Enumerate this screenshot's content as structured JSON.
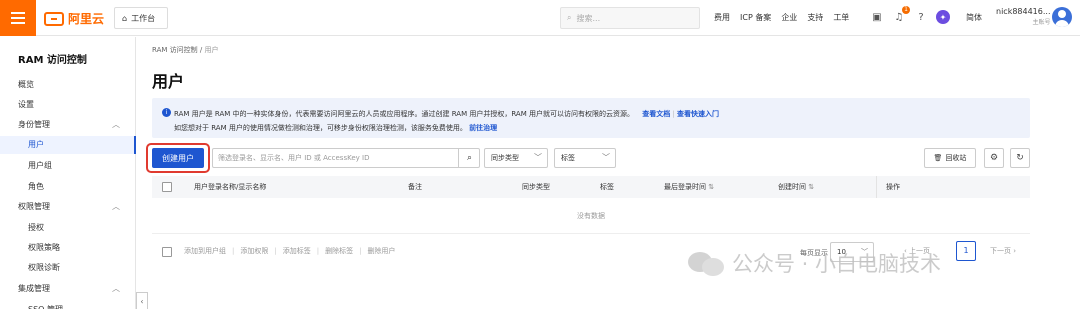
{
  "topbar": {
    "brand": "阿里云",
    "workbench": "工作台",
    "search_placeholder": "搜索...",
    "nav": [
      "费用",
      "ICP 备案",
      "企业",
      "支持",
      "工单"
    ],
    "notification_count": "1",
    "language": "简体",
    "user_name": "nick884416...",
    "user_role": "主账号"
  },
  "sidebar": {
    "title": "RAM 访问控制",
    "items": [
      {
        "label": "概览"
      },
      {
        "label": "设置"
      },
      {
        "label": "身份管理"
      },
      {
        "label": "用户"
      },
      {
        "label": "用户组"
      },
      {
        "label": "角色"
      },
      {
        "label": "权限管理"
      },
      {
        "label": "授权"
      },
      {
        "label": "权限策略"
      },
      {
        "label": "权限诊断"
      },
      {
        "label": "集成管理"
      },
      {
        "label": "SSO 管理"
      }
    ]
  },
  "breadcrumb": [
    "RAM 访问控制",
    "用户"
  ],
  "page_title": "用户",
  "notice": {
    "line1": "RAM 用户是 RAM 中的一种实体身份，代表需要访问阿里云的人员或应用程序。通过创建 RAM 用户并授权，RAM 用户就可以访问有权限的云资源。",
    "link_docs": "查看文档",
    "link_quickstart": "查看快速入门",
    "line2": "如您想对于 RAM 用户的使用情况做检测和治理，可移步身份权限治理检测，该服务免费使用。",
    "link_governance": "前往治理"
  },
  "toolbar": {
    "create_user": "创建用户",
    "filter_placeholder": "筛选登录名、显示名、用户 ID 或 AccessKey ID",
    "sync_type": "同步类型",
    "tag": "标签",
    "recycle_bin": "回收站"
  },
  "table": {
    "columns": [
      "用户登录名称/显示名称",
      "备注",
      "同步类型",
      "标签",
      "最后登录时间",
      "创建时间",
      "操作"
    ],
    "empty_text": "没有数据"
  },
  "footer": {
    "actions": [
      "添加到用户组",
      "添加权限",
      "添加标签",
      "删除标签",
      "删除用户"
    ],
    "page_size_label": "每页显示",
    "page_size": "10",
    "prev": "上一页",
    "page": "1",
    "next": "下一页"
  },
  "watermark": "公众号 · 小白电脑技术",
  "colors": {
    "brand_orange": "#ff6a00",
    "primary_blue": "#1e56d0",
    "highlight_red": "#e03a2f"
  }
}
